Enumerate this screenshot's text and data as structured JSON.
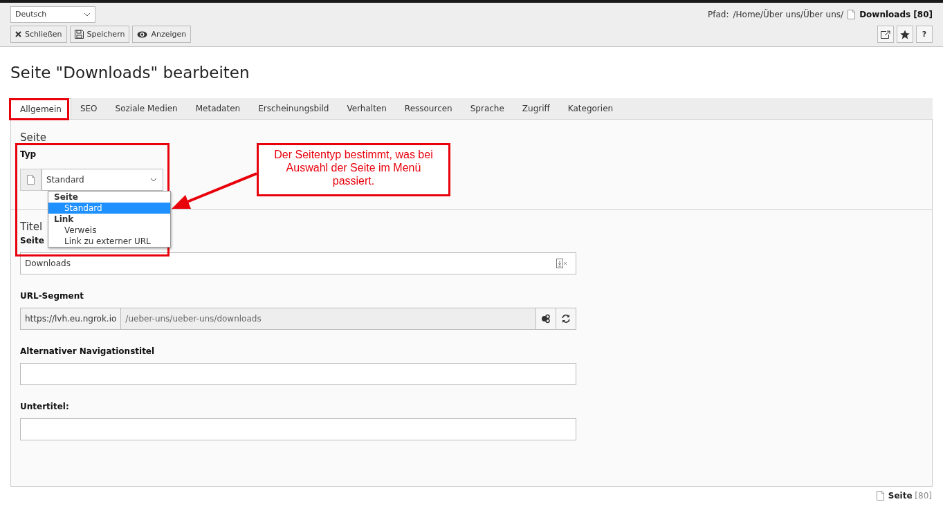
{
  "language_select": {
    "value": "Deutsch"
  },
  "path": {
    "label": "Pfad:",
    "value": "/Home/Über uns/Über uns/",
    "page": "Downloads [80]"
  },
  "buttons": [
    {
      "kind": "close",
      "label": "Schließen"
    },
    {
      "kind": "save",
      "label": "Speichern"
    },
    {
      "kind": "view",
      "label": "Anzeigen"
    }
  ],
  "icon_buttons": [
    {
      "kind": "open"
    },
    {
      "kind": "bookmark"
    },
    {
      "kind": "help",
      "label": "?"
    }
  ],
  "title": "Seite \"Downloads\" bearbeiten",
  "tabs": [
    {
      "label": "Allgemein",
      "selected": true
    },
    {
      "label": "SEO",
      "selected": false
    },
    {
      "label": "Soziale Medien",
      "selected": false
    },
    {
      "label": "Metadaten",
      "selected": false
    },
    {
      "label": "Erscheinungsbild",
      "selected": false
    },
    {
      "label": "Verhalten",
      "selected": false
    },
    {
      "label": "Ressourcen",
      "selected": false
    },
    {
      "label": "Sprache",
      "selected": false
    },
    {
      "label": "Zugriff",
      "selected": false
    },
    {
      "label": "Kategorien",
      "selected": false
    }
  ],
  "type_section": {
    "heading": "Seite",
    "label": "Typ",
    "value": "Standard",
    "dropdown": {
      "expanded": true,
      "groups": [
        {
          "label": "Seite",
          "options": [
            {
              "label": "Standard",
              "selected": true
            }
          ]
        },
        {
          "label": "Link",
          "options": [
            {
              "label": "Verweis",
              "selected": false
            },
            {
              "label": "Link zu externer URL",
              "selected": false
            }
          ]
        }
      ]
    }
  },
  "title_section": {
    "heading": "Titel",
    "fields": [
      {
        "kind": "text_action",
        "label": "Seite",
        "value": "Downloads"
      },
      {
        "kind": "url",
        "label": "URL-Segment",
        "prefix": "https://lvh.eu.ngrok.io",
        "value": "/ueber-uns/ueber-uns/downloads"
      },
      {
        "kind": "text",
        "label": "Alternativer Navigationstitel"
      },
      {
        "kind": "text",
        "label": "Untertitel:"
      }
    ]
  },
  "callout": "Der Seitentyp bestimmt, was bei Auswahl der Seite im Menü passiert.",
  "footer": {
    "label": "Seite",
    "id": "[80]"
  }
}
